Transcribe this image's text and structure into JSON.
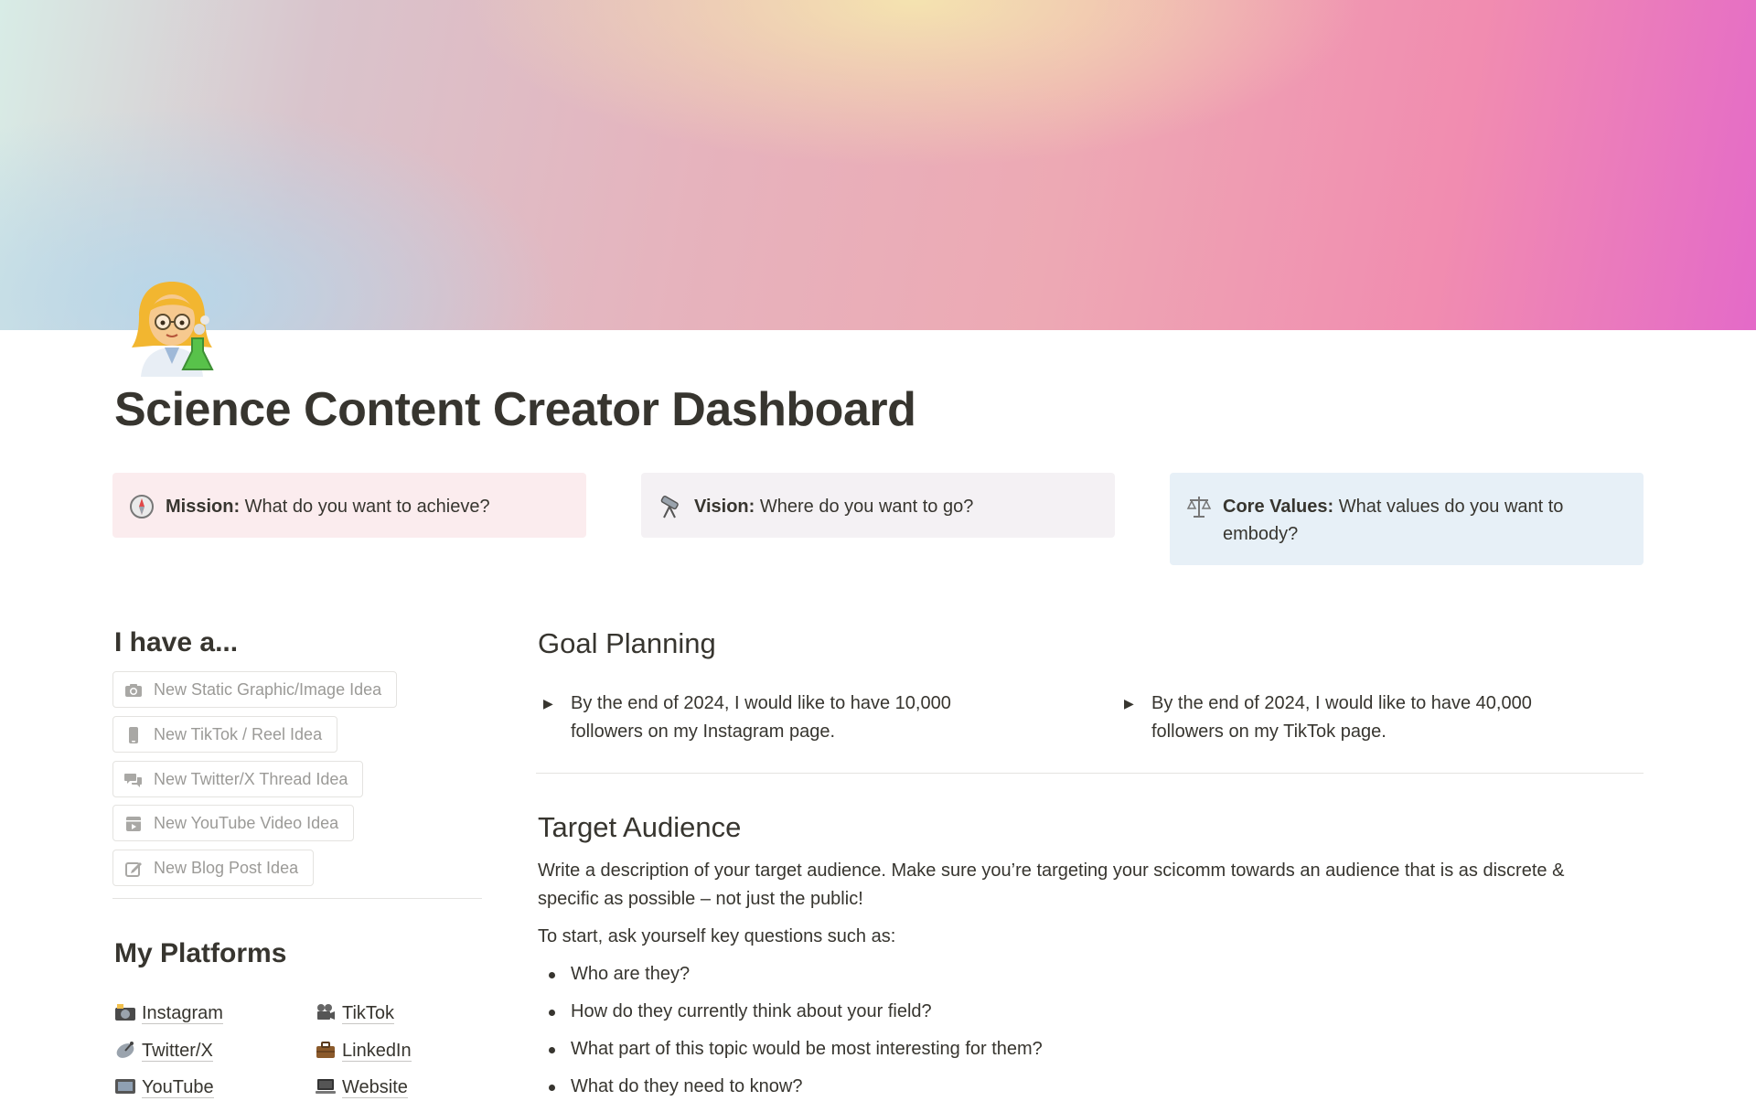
{
  "page": {
    "title": "Science Content Creator Dashboard",
    "icon": "scientist-emoji"
  },
  "callouts": [
    {
      "icon": "compass-icon",
      "label": "Mission:",
      "text": " What do you want to achieve?"
    },
    {
      "icon": "telescope-icon",
      "label": "Vision:",
      "text": " Where do you want to go?"
    },
    {
      "icon": "scales-icon",
      "label": "Core Values:",
      "text": " What values do you want to embody?"
    }
  ],
  "ideas": {
    "heading": "I have a...",
    "buttons": [
      {
        "icon": "camera-icon",
        "label": "New Static Graphic/Image Idea"
      },
      {
        "icon": "phone-icon",
        "label": "New TikTok / Reel Idea"
      },
      {
        "icon": "chat-bubbles-icon",
        "label": "New Twitter/X Thread Idea"
      },
      {
        "icon": "video-clip-icon",
        "label": "New YouTube Video Idea"
      },
      {
        "icon": "compose-icon",
        "label": "New Blog Post Idea"
      }
    ]
  },
  "platforms": {
    "heading": "My Platforms",
    "items": [
      {
        "icon": "camera-flash-emoji",
        "label": "Instagram"
      },
      {
        "icon": "movie-camera-emoji",
        "label": "TikTok"
      },
      {
        "icon": "satellite-dish-emoji",
        "label": "Twitter/X"
      },
      {
        "icon": "briefcase-emoji",
        "label": "LinkedIn"
      },
      {
        "icon": "tv-emoji",
        "label": "YouTube"
      },
      {
        "icon": "laptop-emoji",
        "label": "Website"
      }
    ]
  },
  "goals": {
    "heading": "Goal Planning",
    "toggles": [
      "By the end of 2024, I would like to have 10,000 followers on my Instagram page.",
      "By the end of 2024, I would like to have 40,000 followers on my TikTok page."
    ]
  },
  "audience": {
    "heading": "Target Audience",
    "description": "Write a description of your target audience. Make sure you’re targeting your scicomm towards an audience that is as discrete & specific as possible – not just the public!",
    "prompt": "To start, ask yourself key questions such as:",
    "questions": [
      "Who are they?",
      "How do they currently think about your field?",
      "What part of this topic would be most interesting for them?",
      "What do they need to know?"
    ]
  },
  "colors": {
    "mission_bg": "#fbecee",
    "vision_bg": "#f4f1f4",
    "values_bg": "#e7f0f7",
    "text": "#37352f",
    "muted": "#9b9a97"
  }
}
